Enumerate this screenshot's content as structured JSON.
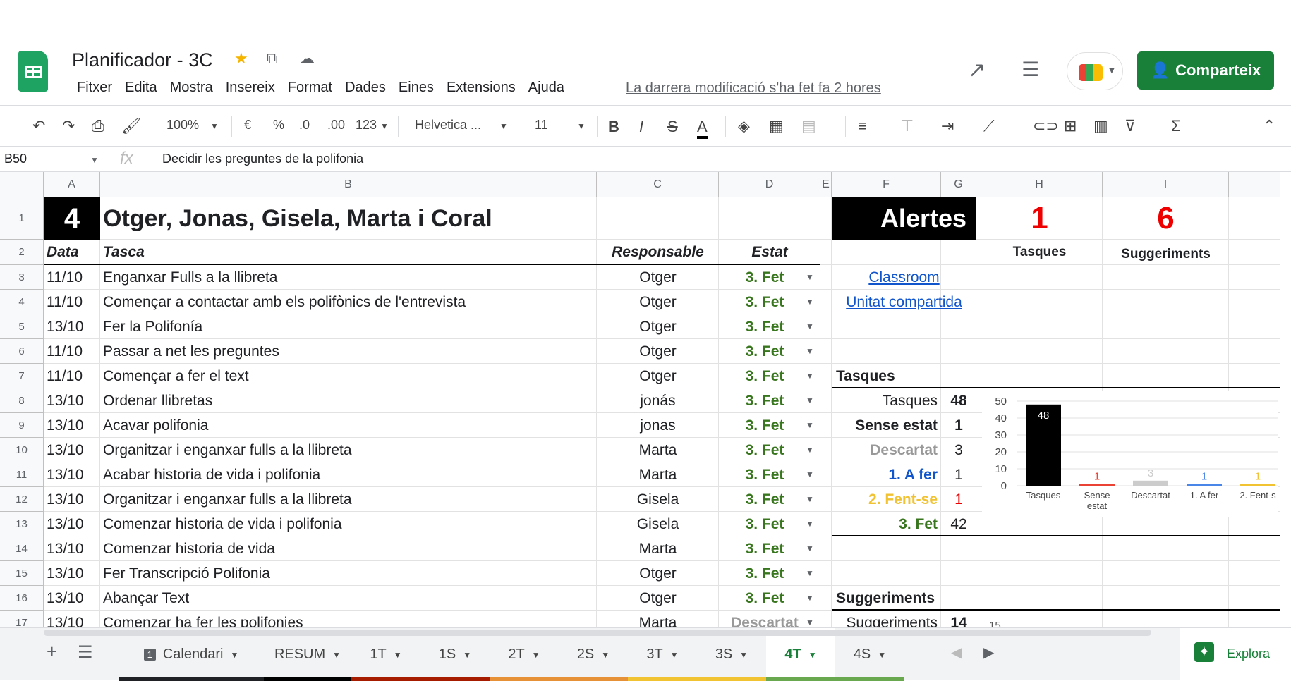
{
  "doc": {
    "title": "Planificador - 3C",
    "last_edit": "La darrera modificació s'ha fet fa 2 hores",
    "share_label": "Comparteix"
  },
  "menu": [
    "Fitxer",
    "Edita",
    "Mostra",
    "Insereix",
    "Format",
    "Dades",
    "Eines",
    "Extensions",
    "Ajuda"
  ],
  "toolbar": {
    "zoom": "100%",
    "currency": "€",
    "percent": "%",
    "dec_less": ".0",
    "dec_more": ".00",
    "format": "123",
    "font": "Helvetica ...",
    "size": "11",
    "bold": "B",
    "italic": "I",
    "strike": "S",
    "color": "A"
  },
  "formula": {
    "cell": "B50",
    "content": "Decidir les preguntes de la polifonia"
  },
  "columns": [
    "A",
    "B",
    "C",
    "D",
    "E",
    "F",
    "G",
    "H",
    "I"
  ],
  "header": {
    "group": "4",
    "members": "Otger, Jonas, Gisela, Marta i Coral",
    "col_date": "Data",
    "col_task": "Tasca",
    "col_resp": "Responsable",
    "col_state": "Estat"
  },
  "rows": [
    {
      "n": "3",
      "date": "11/10",
      "task": "Enganxar Fulls a la llibreta",
      "resp": "Otger",
      "state": "3. Fet"
    },
    {
      "n": "4",
      "date": "11/10",
      "task": "Començar a contactar amb els polifònics de l'entrevista",
      "resp": "Otger",
      "state": "3. Fet"
    },
    {
      "n": "5",
      "date": "13/10",
      "task": "Fer la Polifonía",
      "resp": "Otger",
      "state": "3. Fet"
    },
    {
      "n": "6",
      "date": "11/10",
      "task": "Passar a net les preguntes",
      "resp": "Otger",
      "state": "3. Fet"
    },
    {
      "n": "7",
      "date": "11/10",
      "task": "Començar a fer el text",
      "resp": "Otger",
      "state": "3. Fet"
    },
    {
      "n": "8",
      "date": "13/10",
      "task": "Ordenar llibretas",
      "resp": "jonás",
      "state": "3. Fet"
    },
    {
      "n": "9",
      "date": "13/10",
      "task": "Acavar polifonia",
      "resp": "jonas",
      "state": "3. Fet"
    },
    {
      "n": "10",
      "date": "13/10",
      "task": "Organitzar i enganxar fulls a la llibreta",
      "resp": "Marta",
      "state": "3. Fet"
    },
    {
      "n": "11",
      "date": "13/10",
      "task": "Acabar historia de vida i polifonia",
      "resp": "Marta",
      "state": "3. Fet"
    },
    {
      "n": "12",
      "date": "13/10",
      "task": "Organitzar i enganxar fulls a la llibreta",
      "resp": "Gisela",
      "state": "3. Fet"
    },
    {
      "n": "13",
      "date": "13/10",
      "task": " Comenzar historia de vida i polifonia",
      "resp": "Gisela",
      "state": "3. Fet"
    },
    {
      "n": "14",
      "date": "13/10",
      "task": "Comenzar historia de vida",
      "resp": "Marta",
      "state": "3. Fet"
    },
    {
      "n": "15",
      "date": "13/10",
      "task": "Fer Transcripció Polifonia",
      "resp": "Otger",
      "state": "3. Fet"
    },
    {
      "n": "16",
      "date": "13/10",
      "task": "Abançar Text",
      "resp": "Otger",
      "state": "3. Fet"
    },
    {
      "n": "17",
      "date": "13/10",
      "task": "Comenzar ha fer les polifonies",
      "resp": "Marta",
      "state": "Descartat"
    }
  ],
  "alerts": {
    "title": "Alertes",
    "tasques_count": "1",
    "tasques_label": "Tasques",
    "sugg_count": "6",
    "sugg_label": "Suggeriments"
  },
  "links": [
    "Classroom",
    "Unitat compartida"
  ],
  "stats": {
    "title": "Tasques",
    "items": [
      {
        "label": "Tasques",
        "value": "48",
        "color": "#202124"
      },
      {
        "label": "Sense estat",
        "value": "1",
        "color": "#202124"
      },
      {
        "label": "Descartat",
        "value": "3",
        "color": "#999999"
      },
      {
        "label": "1. A fer",
        "value": "1",
        "color": "#1155cc"
      },
      {
        "label": "2. Fent-se",
        "value": "1",
        "color": "#f1c232"
      },
      {
        "label": "3. Fet",
        "value": "42",
        "color": "#38761d"
      }
    ]
  },
  "sugg": {
    "title": "Suggeriments",
    "label": "Suggeriments",
    "value": "14",
    "chart_tick": "15"
  },
  "chart_data": {
    "type": "bar",
    "categories": [
      "Tasques",
      "Sense estat",
      "Descartat",
      "1. A fer",
      "2. Fent-s"
    ],
    "values": [
      48,
      1,
      3,
      1,
      1
    ],
    "colors": [
      "#000000",
      "#ea4335",
      "#cccccc",
      "#4a86e8",
      "#f1c232"
    ],
    "ylim": [
      0,
      50
    ],
    "yticks": [
      "0",
      "10",
      "20",
      "30",
      "40",
      "50"
    ]
  },
  "sheet_tabs": [
    {
      "label": "Calendari",
      "color": "#202124"
    },
    {
      "label": "RESUM",
      "color": "#000000"
    },
    {
      "label": "1T",
      "color": "#a61c00"
    },
    {
      "label": "1S",
      "color": "#a61c00"
    },
    {
      "label": "2T",
      "color": "#e69138"
    },
    {
      "label": "2S",
      "color": "#e69138"
    },
    {
      "label": "3T",
      "color": "#f1c232"
    },
    {
      "label": "3S",
      "color": "#f1c232"
    },
    {
      "label": "4T",
      "color": "#6aa84f"
    },
    {
      "label": "4S",
      "color": "#6aa84f"
    }
  ],
  "explore_label": "Explora"
}
